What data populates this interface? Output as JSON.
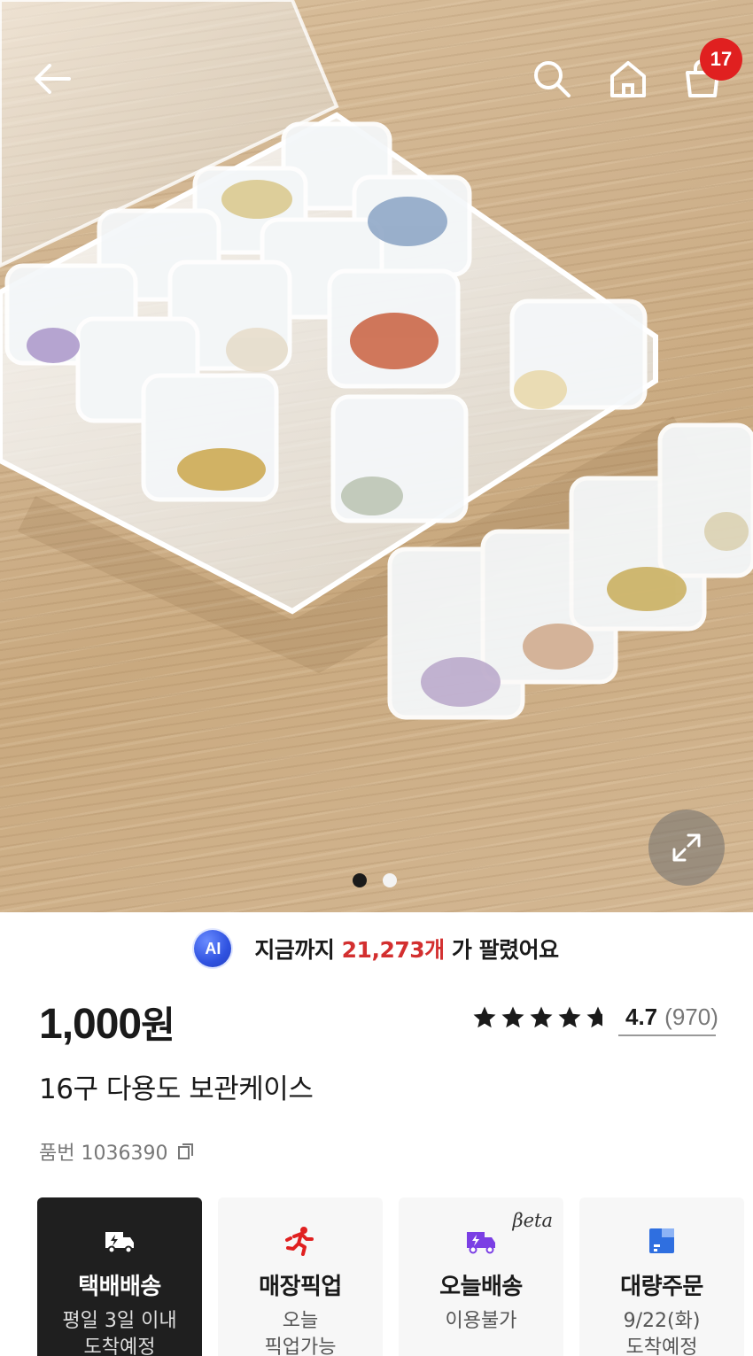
{
  "header": {
    "back": "back-arrow-icon",
    "search": "search-icon",
    "home": "home-icon",
    "cart": "cart-icon",
    "cart_count": "17"
  },
  "gallery": {
    "current_slide": 1,
    "total_slides": 2,
    "zoom": "expand-icon"
  },
  "sold": {
    "ai_label": "AI",
    "prefix": "지금까지",
    "count": "21,273개",
    "suffix": "가 팔렸어요",
    "count_color": "#d32f2f"
  },
  "product": {
    "price": "1,000",
    "price_unit": "원",
    "rating": "4.7",
    "rating_fraction": 0.94,
    "review_count": "(970)",
    "title": "16구 다용도 보관케이스",
    "sku": "품번 1036390"
  },
  "delivery": [
    {
      "title": "택배배송",
      "sub": "평일 3일 이내\n도착예정",
      "icon": "truck-icon",
      "selected": true
    },
    {
      "title": "매장픽업",
      "sub": "오늘\n픽업가능",
      "icon": "running-person-icon",
      "selected": false,
      "icon_color": "#e02020"
    },
    {
      "title": "오늘배송",
      "sub": "이용불가",
      "icon": "fast-truck-icon",
      "selected": false,
      "icon_color": "#7b3fe4",
      "tag": "βeta"
    },
    {
      "title": "대량주문",
      "sub": "9/22(화)\n도착예정",
      "icon": "box-icon",
      "selected": false,
      "icon_color": "#2f6fe0"
    }
  ]
}
